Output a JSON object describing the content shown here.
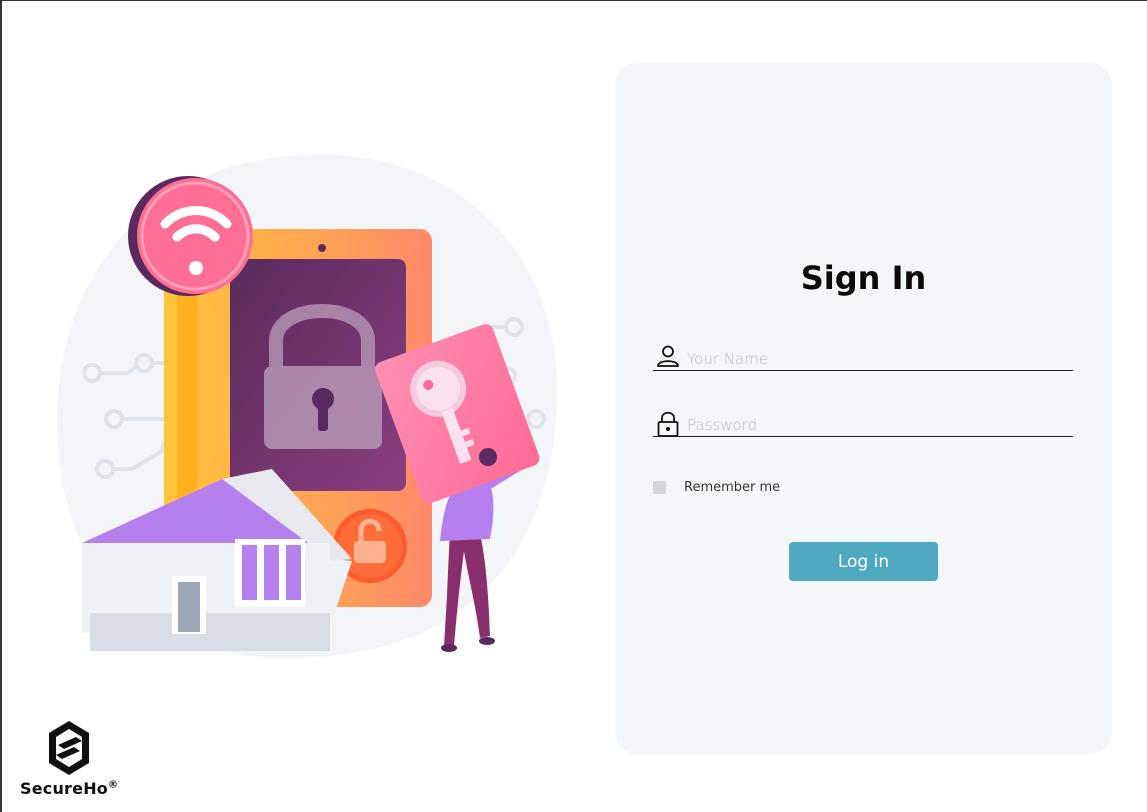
{
  "brand": {
    "name": "SecureHo",
    "mark": "®"
  },
  "signin": {
    "title": "Sign In",
    "name_placeholder": "Your Name",
    "name_value": "",
    "password_placeholder": "Password",
    "password_value": "",
    "remember_label": "Remember me",
    "login_label": "Log in"
  },
  "colors": {
    "accent": "#4ea8c0",
    "card_bg": "#f4f7f9",
    "checkbox": "#d3d6d8"
  },
  "icons": {
    "name_field": "user-icon",
    "password_field": "lock-icon",
    "logo": "secureho-logo-icon"
  }
}
